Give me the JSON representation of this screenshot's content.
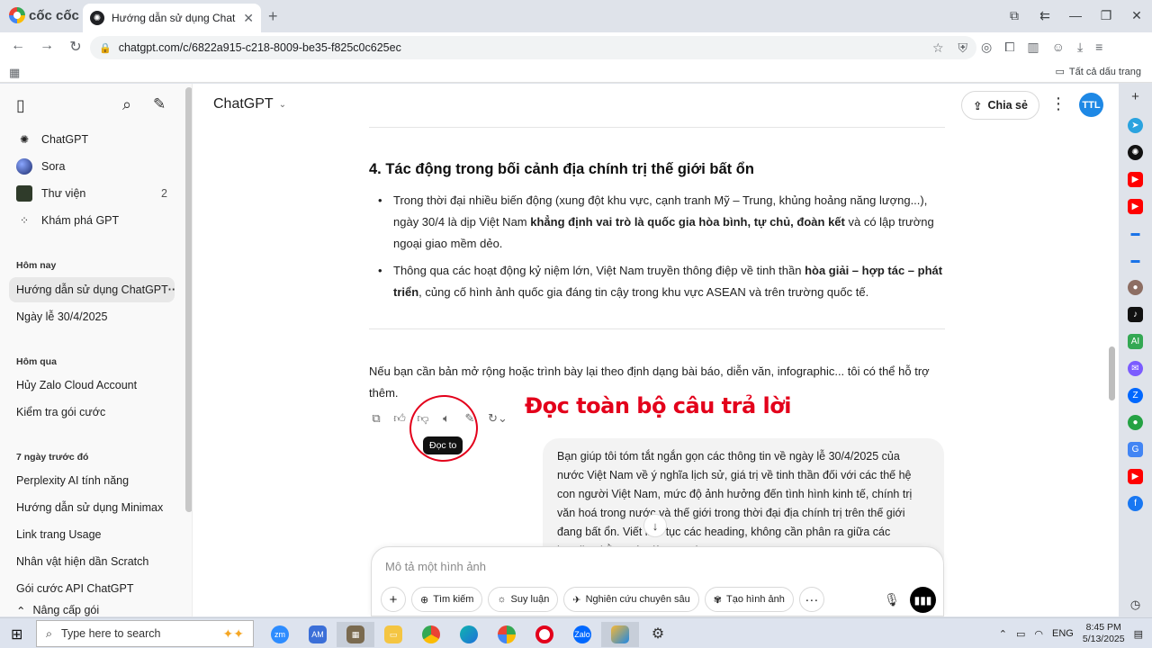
{
  "browser": {
    "brand": "cốc cốc",
    "tab_title": "Hướng dẫn sử dụng ChatGPT",
    "url": "chatgpt.com/c/6822a915-c218-8009-be35-f825c0c625ec",
    "bookmarks_all": "Tất cả dấu trang"
  },
  "sidebar": {
    "top_items": [
      {
        "label": "ChatGPT"
      },
      {
        "label": "Sora"
      },
      {
        "label": "Thư viện",
        "count": "2"
      },
      {
        "label": "Khám phá GPT"
      }
    ],
    "sections": [
      {
        "title": "Hôm nay",
        "items": [
          "Hướng dẫn sử dụng ChatGPT",
          "Ngày lễ 30/4/2025"
        ]
      },
      {
        "title": "Hôm qua",
        "items": [
          "Hủy Zalo Cloud Account",
          "Kiểm tra gói cước"
        ]
      },
      {
        "title": "7 ngày trước đó",
        "items": [
          "Perplexity AI tính năng",
          "Hướng dẫn sử dụng Minimax",
          "Link trang Usage",
          "Nhân vật hiện dần Scratch",
          "Gói cước API ChatGPT"
        ]
      }
    ],
    "upgrade": "Nâng cấp gói"
  },
  "header": {
    "model": "ChatGPT",
    "share": "Chia sẻ",
    "avatar": "TTL"
  },
  "content": {
    "heading": "4. Tác động trong bối cảnh địa chính trị thế giới bất ổn",
    "b1_a": "Trong thời đại nhiều biến động (xung đột khu vực, cạnh tranh Mỹ – Trung, khủng hoảng năng lượng...), ngày 30/4 là dịp Việt Nam ",
    "b1_b": "khẳng định vai trò là quốc gia hòa bình, tự chủ, đoàn kết",
    "b1_c": " và có lập trường ngoại giao mềm dẻo.",
    "b2_a": "Thông qua các hoạt động kỷ niệm lớn, Việt Nam truyền thông điệp về tinh thần ",
    "b2_b": "hòa giải – hợp tác – phát triển",
    "b2_c": ", củng cố hình ảnh quốc gia đáng tin cậy trong khu vực ASEAN và trên trường quốc tế.",
    "followup": "Nếu bạn cần bản mở rộng hoặc trình bày lại theo định dạng bài báo, diễn văn, infographic... tôi có thể hỗ trợ thêm.",
    "tooltip": "Đọc to",
    "annotation": "Đọc toàn bộ câu trả lời",
    "user_message": "Bạn giúp tôi tóm tắt ngắn gọn các thông tin về ngày lễ 30/4/2025 của nước Việt Nam về ý nghĩa lịch sử, giá trị về tinh thần đối với các thế hệ con người Việt Nam, mức độ ảnh hưởng đến tình hình kinh tế, chính trị văn hoá trong nước và thế giới trong thời đại địa chính trị trên thế giới đang bất ổn. Viết liên tục các heading, không cần phân ra giữa các heading bằng các dòng gạch ngang"
  },
  "composer": {
    "placeholder": "Mô tả một hình ảnh",
    "tools": [
      "Tìm kiếm",
      "Suy luận",
      "Nghiên cứu chuyên sâu",
      "Tạo hình ảnh"
    ]
  },
  "taskbar": {
    "search_placeholder": "Type here to search",
    "lang": "ENG",
    "time": "8:45 PM",
    "date": "5/13/2025"
  }
}
